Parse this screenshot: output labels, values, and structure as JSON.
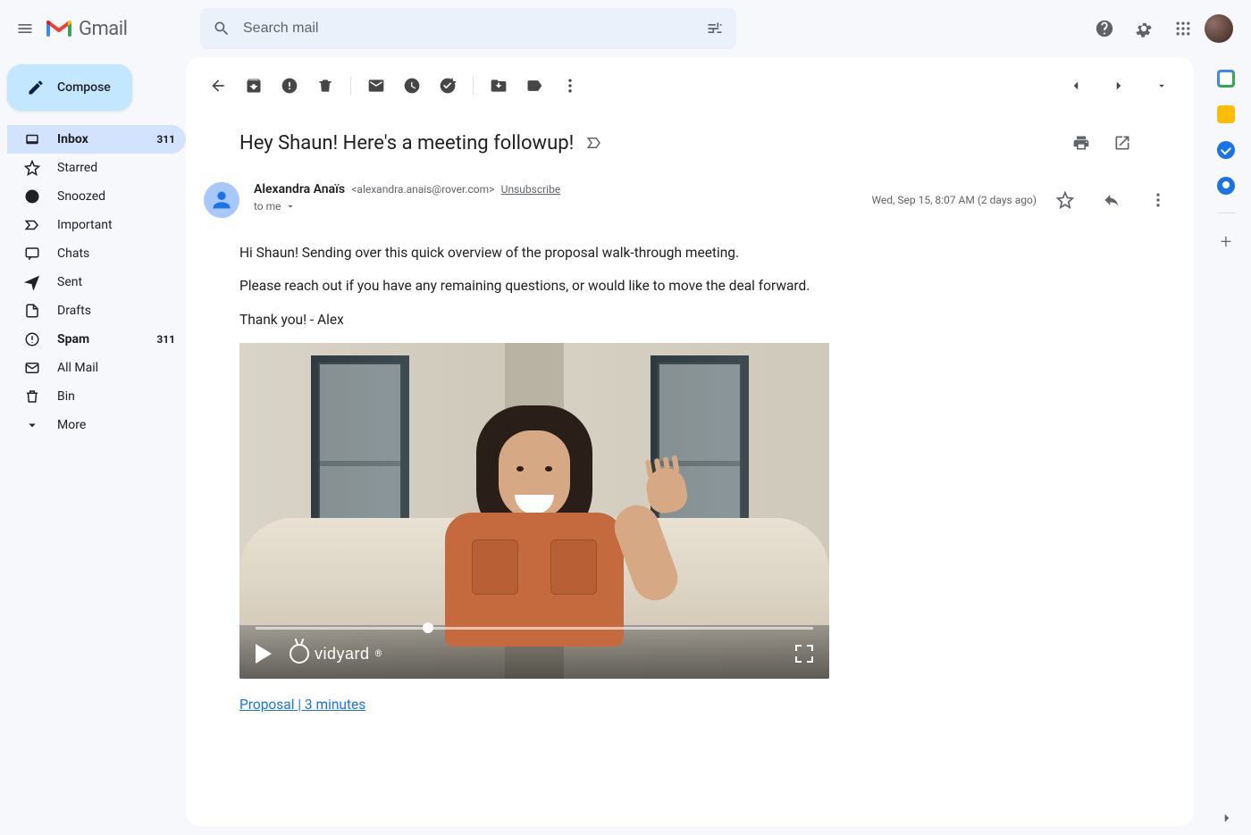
{
  "app": {
    "name": "Gmail",
    "search_placeholder": "Search mail"
  },
  "compose_label": "Compose",
  "sidebar": {
    "items": [
      {
        "icon": "inbox",
        "label": "Inbox",
        "count": "311",
        "active": true,
        "bold": true
      },
      {
        "icon": "star",
        "label": "Starred",
        "count": ""
      },
      {
        "icon": "clock",
        "label": "Snoozed",
        "count": ""
      },
      {
        "icon": "important",
        "label": "Important",
        "count": ""
      },
      {
        "icon": "chat",
        "label": "Chats",
        "count": ""
      },
      {
        "icon": "send",
        "label": "Sent",
        "count": ""
      },
      {
        "icon": "file",
        "label": "Drafts",
        "count": ""
      },
      {
        "icon": "spam",
        "label": "Spam",
        "count": "311",
        "bold": true
      },
      {
        "icon": "mail",
        "label": "All Mail",
        "count": ""
      },
      {
        "icon": "trash",
        "label": "Bin",
        "count": ""
      },
      {
        "icon": "expand",
        "label": "More",
        "count": ""
      }
    ]
  },
  "email": {
    "subject": "Hey Shaun! Here's a meeting followup!",
    "sender_name": "Alexandra Anaïs",
    "sender_email": "<alexandra.anais@rover.com>",
    "unsubscribe": "Unsubscribe",
    "timestamp": "Wed, Sep 15, 8:07 AM (2 days ago)",
    "to_line": "to me",
    "body_p1": "Hi Shaun! Sending over this quick overview of the proposal walk-through meeting.",
    "body_p2": "Please reach out if you have any remaining questions, or would like to move the deal forward.",
    "body_p3": "Thank you! - Alex",
    "video_brand": "vidyard",
    "video_link_text": "Proposal | 3 minutes"
  }
}
